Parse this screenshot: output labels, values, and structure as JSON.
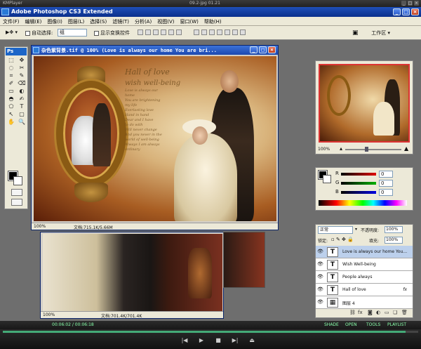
{
  "player": {
    "title": "KMPlayer",
    "center_title": "09.2-jpg 01.21",
    "status_time": "00:06:02 / 00:06:18",
    "status_right": [
      "SHADE",
      "OPEN",
      "TOOLS",
      "PLAYLIST"
    ],
    "progress": 0.97,
    "controls": [
      "|◀",
      "▶",
      "■",
      "▶|",
      "⏏"
    ]
  },
  "photoshop": {
    "title": "Adobe Photoshop CS3 Extended",
    "menu": [
      "文件(F)",
      "编辑(E)",
      "图像(I)",
      "图层(L)",
      "选择(S)",
      "滤镜(T)",
      "分析(A)",
      "视图(V)",
      "窗口(W)",
      "帮助(H)"
    ],
    "options": {
      "auto_select_label": "自动选择:",
      "auto_select_value": "组",
      "show_transform_label": "显示变换控件",
      "workspace_label": "工作区 ▾"
    },
    "toolbox_badge": "Ps",
    "tools": [
      "⬚",
      "✥",
      "◌",
      "✂",
      "⌗",
      "✎",
      "✐",
      "⌫",
      "▭",
      "◐",
      "◓",
      "✍",
      "⬠",
      "T",
      "↖",
      "▢",
      "✋",
      "🔍"
    ]
  },
  "main_doc": {
    "title": "杂色紫背景.tif @ 100% (Love is always our home    You are bri...",
    "zoom": "100%",
    "doc_size": "文档:715.1K/5.66M",
    "art": {
      "script_heading": "Hall of love",
      "script_sub": "wish well-being",
      "script_body": [
        "Love is always our",
        "home",
        "You are brightening",
        "my life",
        "Everlasting love",
        "Hand in hand",
        "Dear and I have",
        "to do with",
        "Will never change",
        "And you never in the",
        "world of well-being",
        "Always I am always",
        "ordinary"
      ]
    }
  },
  "back_doc_left": {
    "zoom": "100%",
    "doc_size": "文档:701.4K/701.4K"
  },
  "navigator": {
    "zoom": "100%"
  },
  "color_panel": {
    "channels": [
      {
        "label": "R",
        "value": "0",
        "color": "#e00000"
      },
      {
        "label": "G",
        "value": "0",
        "color": "#00b000"
      },
      {
        "label": "B",
        "value": "0",
        "color": "#0000e0"
      }
    ]
  },
  "layers_panel": {
    "blend_mode": "正常",
    "opacity_label": "不透明度:",
    "opacity_value": "100%",
    "lock_label": "锁定:",
    "fill_label": "填充:",
    "fill_value": "100%",
    "layers": [
      {
        "name": "Love is always our home    You...",
        "thumb": "T",
        "active": true
      },
      {
        "name": "Wish Well-being",
        "thumb": "T",
        "active": false
      },
      {
        "name": "People always",
        "thumb": "T",
        "active": false
      },
      {
        "name": "Hall of love",
        "thumb": "T",
        "active": false,
        "fx": "fx"
      },
      {
        "name": "图层 4",
        "thumb": "▦",
        "active": false
      }
    ]
  }
}
